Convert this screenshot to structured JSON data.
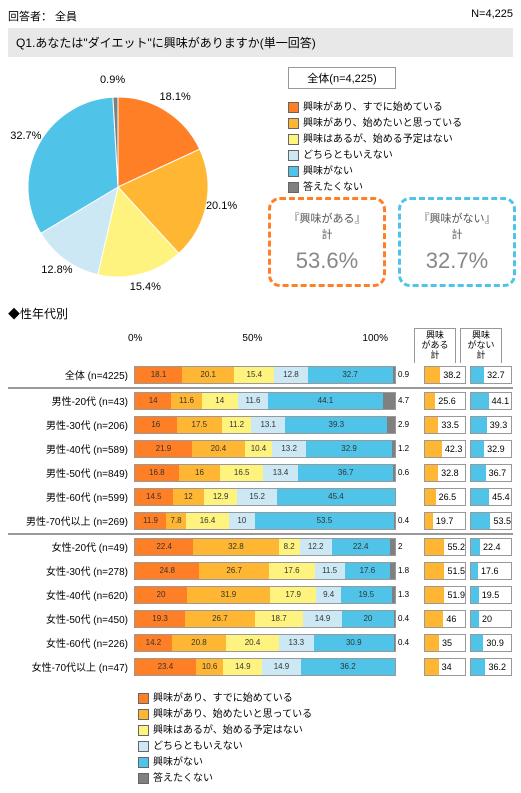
{
  "header": {
    "respondent": "回答者： 全員",
    "n": "N=4,225"
  },
  "question": "Q1.あなたは\"ダイエット\"に興味がありますか(単一回答)",
  "overall_label": "全体(n=4,225)",
  "colors": {
    "c1": "#ff7f27",
    "c2": "#ffb733",
    "c3": "#fff380",
    "c4": "#cce8f4",
    "c5": "#4fc4e8",
    "c6": "#808080",
    "sum_yes": "#ffb733",
    "sum_no": "#4fc4e8"
  },
  "legend": [
    "興味があり、すでに始めている",
    "興味があり、始めたいと思っている",
    "興味はあるが、始める予定はない",
    "どちらともいえない",
    "興味がない",
    "答えたくない"
  ],
  "box_yes": {
    "title": "『興味がある』計",
    "value": "53.6%"
  },
  "box_no": {
    "title": "『興味がない』計",
    "value": "32.7%"
  },
  "subtitle": "◆性年代別",
  "sum_headers": {
    "yes": "興味\nがある\n計",
    "no": "興味\nがない\n計"
  },
  "axis": [
    "0%",
    "50%",
    "100%"
  ],
  "chart_data": {
    "type": "pie_and_stacked_bar",
    "pie": {
      "series": [
        {
          "label": "興味があり、すでに始めている",
          "value": 18.1
        },
        {
          "label": "興味があり、始めたいと思っている",
          "value": 20.1
        },
        {
          "label": "興味はあるが、始める予定はない",
          "value": 15.4
        },
        {
          "label": "どちらともいえない",
          "value": 12.8
        },
        {
          "label": "興味がない",
          "value": 32.7
        },
        {
          "label": "答えたくない",
          "value": 0.9
        }
      ]
    },
    "stacked": {
      "categories": [
        "興味があり、すでに始めている",
        "興味があり、始めたいと思っている",
        "興味はあるが、始める予定はない",
        "どちらともいえない",
        "興味がない",
        "答えたくない"
      ],
      "rows": [
        {
          "label": "全体 (n=4225)",
          "v": [
            18.1,
            20.1,
            15.4,
            12.8,
            32.7,
            0.9
          ],
          "yes": 38.2,
          "no": 32.7,
          "sep": "bot"
        },
        {
          "label": "男性-20代 (n=43)",
          "v": [
            14.0,
            11.6,
            14,
            11.6,
            44.1,
            4.7
          ],
          "yes": 25.6,
          "no": 44.1,
          "sep": "top"
        },
        {
          "label": "男性-30代 (n=206)",
          "v": [
            16.0,
            17.5,
            11.2,
            13.1,
            39.3,
            2.9
          ],
          "yes": 33.5,
          "no": 39.3
        },
        {
          "label": "男性-40代 (n=589)",
          "v": [
            21.9,
            20.4,
            10.4,
            13.2,
            32.9,
            1.2
          ],
          "yes": 42.3,
          "no": 32.9
        },
        {
          "label": "男性-50代 (n=849)",
          "v": [
            16.8,
            16,
            16.5,
            13.4,
            36.7,
            0.6
          ],
          "yes": 32.8,
          "no": 36.7
        },
        {
          "label": "男性-60代 (n=599)",
          "v": [
            14.5,
            12,
            12.9,
            15.2,
            45.4,
            0
          ],
          "yes": 26.5,
          "no": 45.4
        },
        {
          "label": "男性-70代以上 (n=269)",
          "v": [
            11.9,
            7.8,
            16.4,
            10,
            53.5,
            0.4
          ],
          "yes": 19.7,
          "no": 53.5,
          "sep": "bot"
        },
        {
          "label": "女性-20代 (n=49)",
          "v": [
            22.4,
            32.8,
            8.2,
            12.2,
            22.4,
            2.0
          ],
          "yes": 55.2,
          "no": 22.4,
          "sep": "top"
        },
        {
          "label": "女性-30代 (n=278)",
          "v": [
            24.8,
            26.7,
            17.6,
            11.5,
            17.6,
            1.8
          ],
          "yes": 51.5,
          "no": 17.6
        },
        {
          "label": "女性-40代 (n=620)",
          "v": [
            20.0,
            31.9,
            17.9,
            9.4,
            19.5,
            1.3
          ],
          "yes": 51.9,
          "no": 19.5
        },
        {
          "label": "女性-50代 (n=450)",
          "v": [
            19.3,
            26.7,
            18.7,
            14.9,
            20,
            0.4
          ],
          "yes": 46.0,
          "no": 20.0
        },
        {
          "label": "女性-60代 (n=226)",
          "v": [
            14.2,
            20.8,
            20.4,
            13.3,
            30.9,
            0.4
          ],
          "yes": 35.0,
          "no": 30.9
        },
        {
          "label": "女性-70代以上 (n=47)",
          "v": [
            23.4,
            10.6,
            14.9,
            14.9,
            36.2,
            0
          ],
          "yes": 34.0,
          "no": 36.2
        }
      ]
    }
  }
}
